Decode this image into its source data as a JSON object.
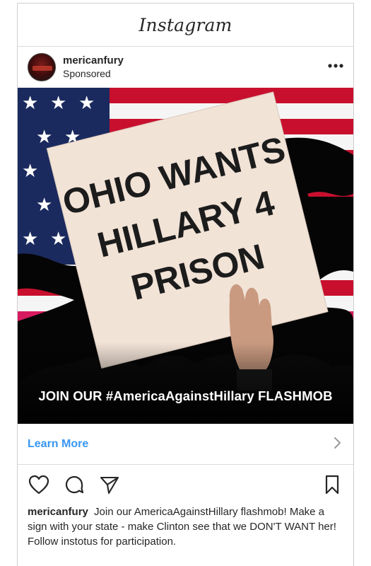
{
  "app": {
    "title": "Instagram"
  },
  "post": {
    "username": "mericanfury",
    "sponsored_label": "Sponsored",
    "more_icon": "more-horizontal-icon",
    "image": {
      "sign_line_1": "OHIO WANTS",
      "sign_line_2": "HILLARY 4",
      "sign_line_3": "PRISON",
      "overlay_text": "JOIN OUR #AmericaAgainstHillary FLASHMOB"
    },
    "cta_label": "Learn More",
    "cta_icon": "chevron-right-icon",
    "actions": {
      "like_icon": "heart-icon",
      "comment_icon": "comment-icon",
      "share_icon": "share-icon",
      "save_icon": "bookmark-icon"
    },
    "caption_user": "mericanfury",
    "caption_text": "Join our AmericaAgainstHillary flashmob! Make a sign with your state - make Clinton see that we DON'T WANT her! Follow instotus for participation."
  },
  "colors": {
    "link_blue": "#3897f0",
    "flag_red": "#c8102e",
    "flag_blue": "#1b2a5e",
    "sign": "#f2e3d7"
  }
}
